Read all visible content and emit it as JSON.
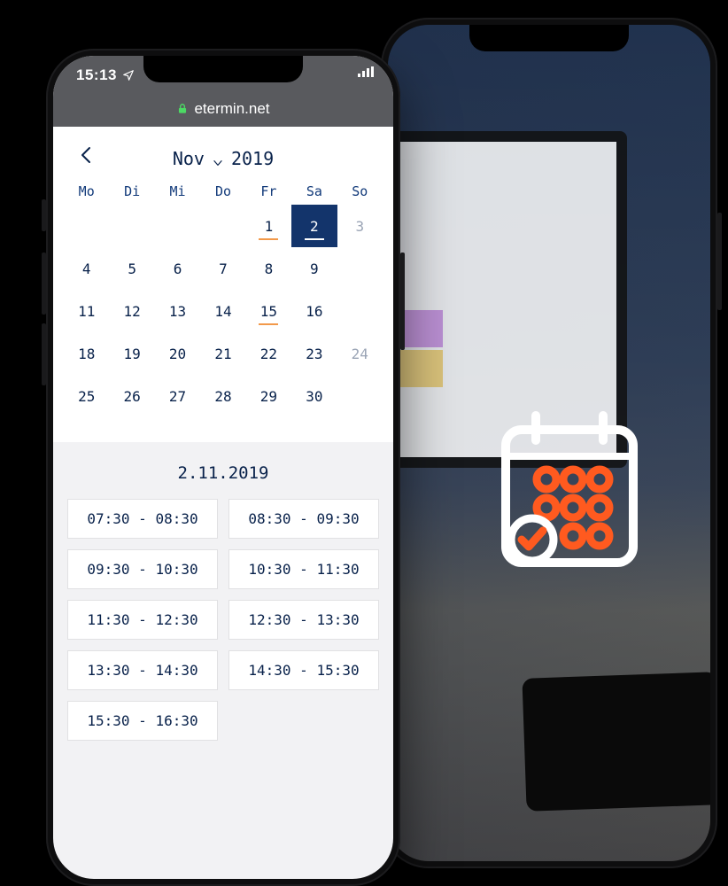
{
  "statusbar": {
    "time": "15:13",
    "url_domain": "etermin.net",
    "lock_color": "#4cd964"
  },
  "calendar": {
    "month_label": "Nov",
    "year_label": "2019",
    "weekdays": [
      "Mo",
      "Di",
      "Mi",
      "Do",
      "Fr",
      "Sa",
      "So"
    ],
    "rows": [
      [
        "",
        "",
        "",
        "",
        "1",
        "2",
        "3"
      ],
      [
        "4",
        "5",
        "6",
        "7",
        "8",
        "9",
        ""
      ],
      [
        "11",
        "12",
        "13",
        "14",
        "15",
        "16",
        ""
      ],
      [
        "18",
        "19",
        "20",
        "21",
        "22",
        "23",
        "24"
      ],
      [
        "25",
        "26",
        "27",
        "28",
        "29",
        "30",
        ""
      ]
    ],
    "today_cells": [
      "1",
      "15"
    ],
    "selected_cell": "2",
    "dim_cells": [
      "3",
      "24"
    ]
  },
  "slots": {
    "date_label": "2.11.2019",
    "items": [
      "07:30 - 08:30",
      "08:30 - 09:30",
      "09:30 - 10:30",
      "10:30 - 11:30",
      "11:30 - 12:30",
      "12:30 - 13:30",
      "13:30 - 14:30",
      "14:30 - 15:30",
      "15:30 - 16:30"
    ]
  },
  "promo_icon": {
    "accent": "#ff5a1f",
    "outline": "#ffffff"
  }
}
